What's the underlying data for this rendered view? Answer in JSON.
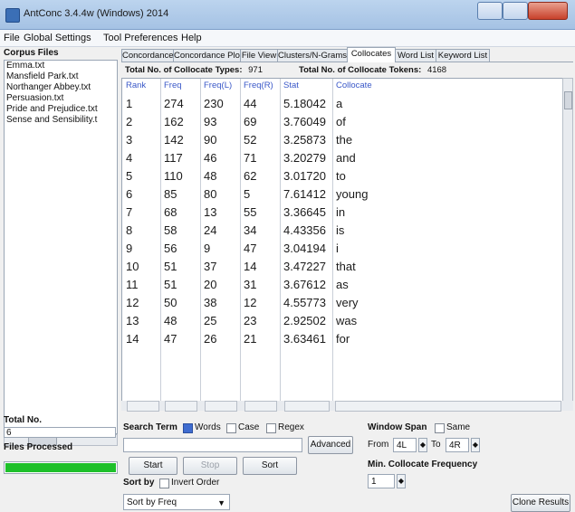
{
  "window": {
    "title": "AntConc 3.4.4w (Windows) 2014"
  },
  "menu": [
    "File",
    "Global Settings",
    "Tool Preferences",
    "Help"
  ],
  "sidebar": {
    "corpus_label": "Corpus Files",
    "files": [
      "Emma.txt",
      "Mansfield Park.txt",
      "Northanger Abbey.txt",
      "Persuasion.txt",
      "Pride and Prejudice.txt",
      "Sense and Sensibility.t"
    ],
    "total_label": "Total No.",
    "total_value": "6",
    "processed_label": "Files Processed",
    "progress": 1.0
  },
  "tabs": [
    "Concordance",
    "Concordance Plot",
    "File View",
    "Clusters/N-Grams",
    "Collocates",
    "Word List",
    "Keyword List"
  ],
  "active_tab": "Collocates",
  "totals": {
    "types_label": "Total No. of Collocate Types:",
    "types_value": "971",
    "tokens_label": "Total No. of Collocate Tokens:",
    "tokens_value": "4168"
  },
  "columns": [
    "Rank",
    "Freq",
    "Freq(L)",
    "Freq(R)",
    "Stat",
    "Collocate"
  ],
  "rows": [
    [
      "1",
      "274",
      "230",
      "44",
      "5.18042",
      "a"
    ],
    [
      "2",
      "162",
      "93",
      "69",
      "3.76049",
      "of"
    ],
    [
      "3",
      "142",
      "90",
      "52",
      "3.25873",
      "the"
    ],
    [
      "4",
      "117",
      "46",
      "71",
      "3.20279",
      "and"
    ],
    [
      "5",
      "110",
      "48",
      "62",
      "3.01720",
      "to"
    ],
    [
      "6",
      "85",
      "80",
      "5",
      "7.61412",
      "young"
    ],
    [
      "7",
      "68",
      "13",
      "55",
      "3.36645",
      "in"
    ],
    [
      "8",
      "58",
      "24",
      "34",
      "4.43356",
      "is"
    ],
    [
      "9",
      "56",
      "9",
      "47",
      "3.04194",
      "i"
    ],
    [
      "10",
      "51",
      "37",
      "14",
      "3.47227",
      "that"
    ],
    [
      "11",
      "51",
      "20",
      "31",
      "3.67612",
      "as"
    ],
    [
      "12",
      "50",
      "38",
      "12",
      "4.55773",
      "very"
    ],
    [
      "13",
      "48",
      "25",
      "23",
      "2.92502",
      "was"
    ],
    [
      "14",
      "47",
      "26",
      "21",
      "3.63461",
      "for"
    ]
  ],
  "search": {
    "label": "Search Term",
    "words_label": "Words",
    "case_label": "Case",
    "regex_label": "Regex",
    "advanced_label": "Advanced",
    "value": ""
  },
  "buttons": {
    "start": "Start",
    "stop": "Stop",
    "sort": "Sort",
    "clone": "Clone Results"
  },
  "window_span": {
    "label": "Window Span",
    "same_label": "Same",
    "from_label": "From",
    "from_value": "4L",
    "to_label": "To",
    "to_value": "4R"
  },
  "min_freq": {
    "label": "Min. Collocate Frequency",
    "value": "1"
  },
  "sort": {
    "label": "Sort by",
    "invert_label": "Invert Order",
    "selected": "Sort by Freq"
  }
}
